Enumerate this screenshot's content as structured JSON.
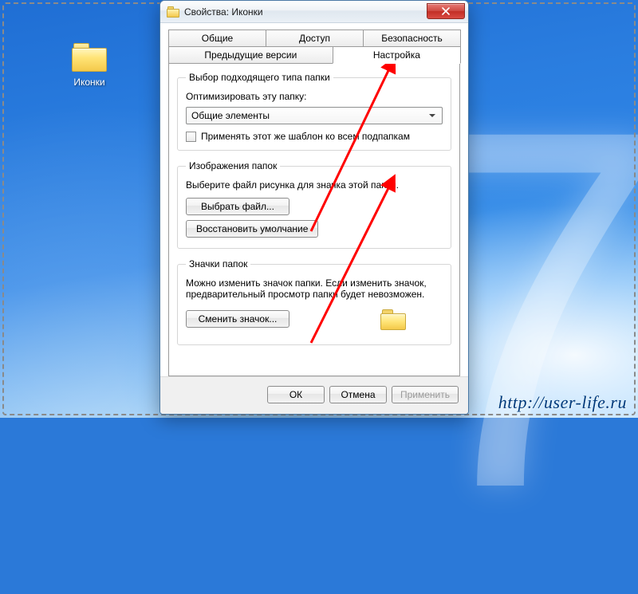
{
  "desktop": {
    "icon_label": "Иконки"
  },
  "dialog": {
    "title": "Свойства: Иконки",
    "tabs": {
      "row1": [
        "Общие",
        "Доступ",
        "Безопасность"
      ],
      "row2": [
        "Предыдущие версии",
        "Настройка"
      ],
      "active": "Настройка"
    },
    "section_type": {
      "legend": "Выбор подходящего типа папки",
      "optimize_label": "Оптимизировать эту папку:",
      "combo_value": "Общие элементы",
      "apply_subfolders": "Применять этот же шаблон ко всем подпапкам"
    },
    "section_images": {
      "legend": "Изображения папок",
      "desc": "Выберите файл рисунка для значка этой папки.",
      "choose_btn": "Выбрать файл...",
      "restore_btn": "Восстановить умолчание"
    },
    "section_icons": {
      "legend": "Значки папок",
      "desc": "Можно изменить значок папки. Если изменить значок, предварительный просмотр папки будет невозможен.",
      "change_btn": "Сменить значок..."
    },
    "footer": {
      "ok": "ОК",
      "cancel": "Отмена",
      "apply": "Применить"
    }
  },
  "watermark": "http://user-life.ru",
  "icons": {
    "folder": "folder-icon",
    "close": "close-icon",
    "caret": "chevron-down-icon"
  }
}
